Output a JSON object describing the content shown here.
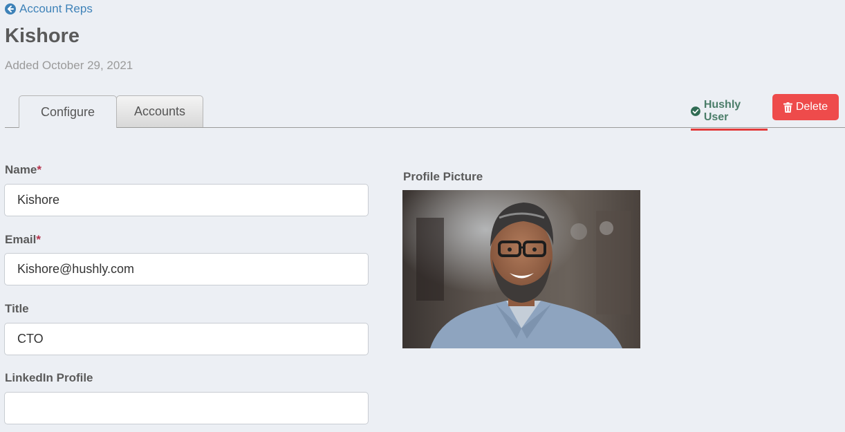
{
  "nav": {
    "back_label": "Account Reps"
  },
  "header": {
    "title": "Kishore",
    "added": "Added October 29, 2021"
  },
  "tabs": [
    {
      "label": "Configure",
      "active": true
    },
    {
      "label": "Accounts",
      "active": false
    }
  ],
  "status": {
    "label": "Hushly User",
    "color": "#4b7d69",
    "underline_color": "#e23b3b"
  },
  "actions": {
    "delete_label": "Delete",
    "delete_color": "#ee4b4b"
  },
  "form": {
    "name": {
      "label": "Name",
      "required_mark": "*",
      "value": "Kishore"
    },
    "email": {
      "label": "Email",
      "required_mark": "*",
      "value": "Kishore@hushly.com"
    },
    "title": {
      "label": "Title",
      "value": "CTO"
    },
    "linkedin": {
      "label": "LinkedIn Profile",
      "value": ""
    }
  },
  "profile": {
    "label": "Profile Picture"
  },
  "icons": {
    "back": "arrow-circle-left-icon",
    "status": "check-circle-icon",
    "delete": "trash-icon"
  },
  "colors": {
    "link": "#3e82b8",
    "background": "#eceff4"
  }
}
